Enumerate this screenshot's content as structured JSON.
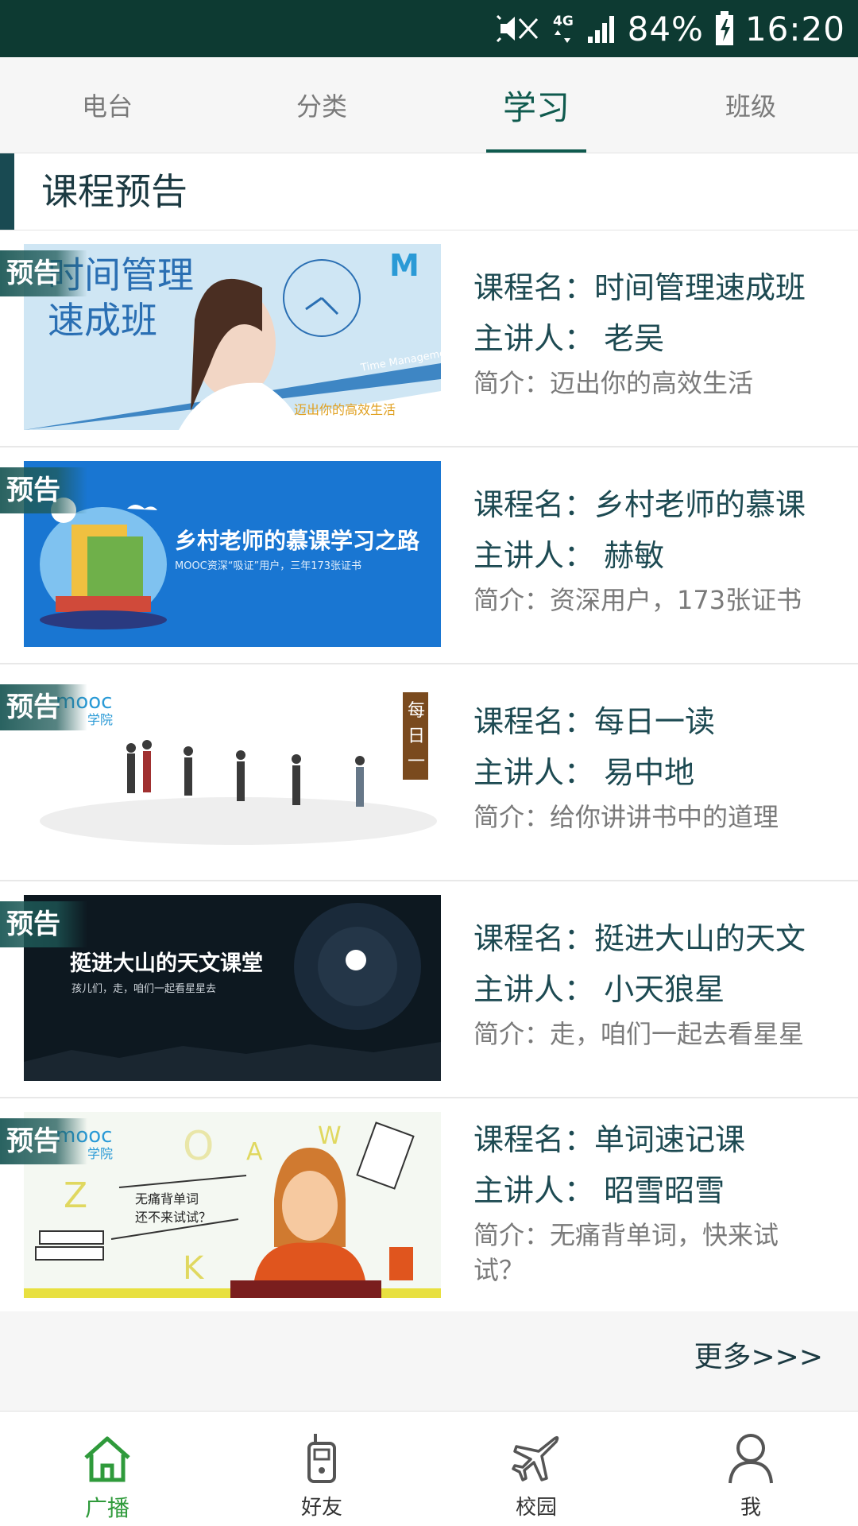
{
  "status_bar": {
    "battery": "84%",
    "time": "16:20",
    "network": "4G"
  },
  "top_tabs": [
    {
      "label": "电台",
      "active": false
    },
    {
      "label": "分类",
      "active": false
    },
    {
      "label": "学习",
      "active": true
    },
    {
      "label": "班级",
      "active": false
    }
  ],
  "section": {
    "title": "课程预告"
  },
  "courses": [
    {
      "badge": "预告",
      "name": "课程名：时间管理速成班",
      "teacher": "主讲人： 老吴",
      "intro": "简介：迈出你的高效生活",
      "thumb": {
        "title_line1": "时间管理",
        "title_line2": "速成班",
        "subtitle": "迈出你的高效生活",
        "caption": "Time Management"
      }
    },
    {
      "badge": "预告",
      "name": "课程名：乡村老师的慕课",
      "teacher": "主讲人： 赫敏",
      "intro": "简介：资深用户，173张证书",
      "thumb": {
        "title": "乡村老师的慕课学习之路",
        "subtitle": "MOOC资深“吸证”用户，三年173张证书"
      }
    },
    {
      "badge": "预告",
      "name": "课程名：每日一读",
      "teacher": "主讲人： 易中地",
      "intro": "简介：给你讲讲书中的道理",
      "thumb": {
        "logo": "mooc",
        "logo_sub": "学院",
        "tag": "每日一读"
      }
    },
    {
      "badge": "预告",
      "name": "课程名：挺进大山的天文",
      "teacher": "主讲人： 小天狼星",
      "intro": "简介：走，咱们一起去看星星",
      "thumb": {
        "title": "挺进大山的天文课堂",
        "subtitle": "孩儿们，走，咱们一起看星星去"
      }
    },
    {
      "badge": "预告",
      "name": "课程名：单词速记课",
      "teacher": "主讲人： 昭雪昭雪",
      "intro": "简介：无痛背单词，快来试试？",
      "thumb": {
        "logo": "mooc",
        "logo_sub": "学院",
        "bubble1": "无痛背单词",
        "bubble2": "还不来试试？"
      }
    }
  ],
  "more": {
    "label": "更多>>>"
  },
  "bottom_nav": [
    {
      "label": "广播",
      "icon": "home-icon",
      "active": true
    },
    {
      "label": "好友",
      "icon": "walkie-talkie-icon",
      "active": false
    },
    {
      "label": "校园",
      "icon": "airplane-icon",
      "active": false
    },
    {
      "label": "我",
      "icon": "person-icon",
      "active": false
    }
  ],
  "colors": {
    "accent": "#0f5a4e",
    "status_bar": "#0d3a32",
    "nav_active": "#2f9a3b"
  }
}
